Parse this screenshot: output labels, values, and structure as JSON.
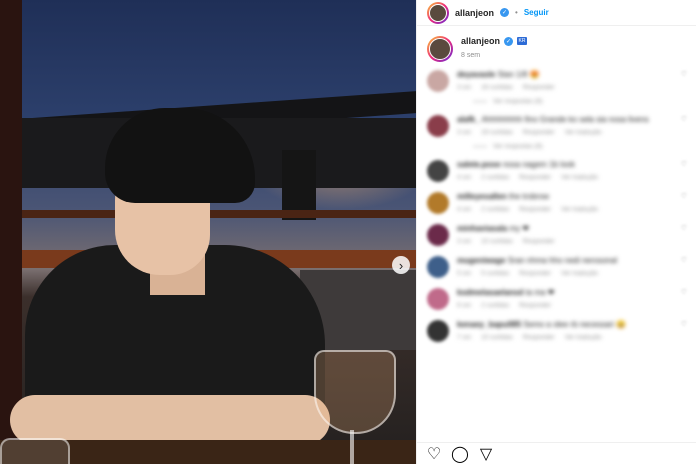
{
  "header": {
    "username": "allanjeon",
    "separator": "•",
    "follow_label": "Seguir"
  },
  "caption": {
    "username": "allanjeon",
    "flag_label": "KR",
    "time": "8 sem"
  },
  "comments": [
    {
      "user": "deyavasle",
      "text": "Stan 1/8 😍",
      "time": "3 sm",
      "likes": "16 curtidas",
      "reply": "Responder",
      "translate": "",
      "avatar_color": "#c9a7a3"
    },
    {
      "user": "alafk_",
      "text": "Ahhhhhhhh fino Grande ko sela sia nosa livens",
      "time": "3 sm",
      "likes": "19 curtidas",
      "reply": "Responder",
      "translate": "Ver tradução",
      "avatar_color": "#8a3d4a"
    },
    {
      "user": "salete.pose",
      "text": "nosa nagem 1b look",
      "time": "4 sm",
      "likes": "2 curtidas",
      "reply": "Responder",
      "translate": "Ver tradução",
      "avatar_color": "#444444"
    },
    {
      "user": "milleyesallen",
      "text": "the trobrow",
      "time": "4 sm",
      "likes": "2 curtidas",
      "reply": "Responder",
      "translate": "Ver tradução",
      "avatar_color": "#b27a2a"
    },
    {
      "user": "minhaviasala",
      "text": "my ❤",
      "time": "3 sm",
      "likes": "10 curtidas",
      "reply": "Responder",
      "translate": "",
      "avatar_color": "#6b2a4a"
    },
    {
      "user": "mugeniwage",
      "text": "Sran nhma hho nedi nerosonal",
      "time": "5 sm",
      "likes": "5 curtidas",
      "reply": "Responder",
      "translate": "Ver tradução",
      "avatar_color": "#3e5f8a"
    },
    {
      "user": "ksdmelasaelansd",
      "text": "ta ma ❤",
      "time": "6 sm",
      "likes": "2 curtidas",
      "reply": "Responder",
      "translate": "",
      "avatar_color": "#c06a8a"
    },
    {
      "user": "kenaey_bapull85",
      "text": "Semo a olee rb necessari 😄",
      "time": "7 sm",
      "likes": "10 curtidas",
      "reply": "Responder",
      "translate": "Ver tradução",
      "avatar_color": "#333333"
    }
  ],
  "reply_threads": {
    "first": "Ver respostas (6)",
    "second": "Ver respostas (6)"
  },
  "photo": {
    "next_glyph": "›"
  },
  "actions": {
    "like_icon": "♡",
    "comment_icon": "◯",
    "share_icon": "▽"
  },
  "colors": {
    "accent": "#0095f6",
    "verified": "#3897f0"
  }
}
